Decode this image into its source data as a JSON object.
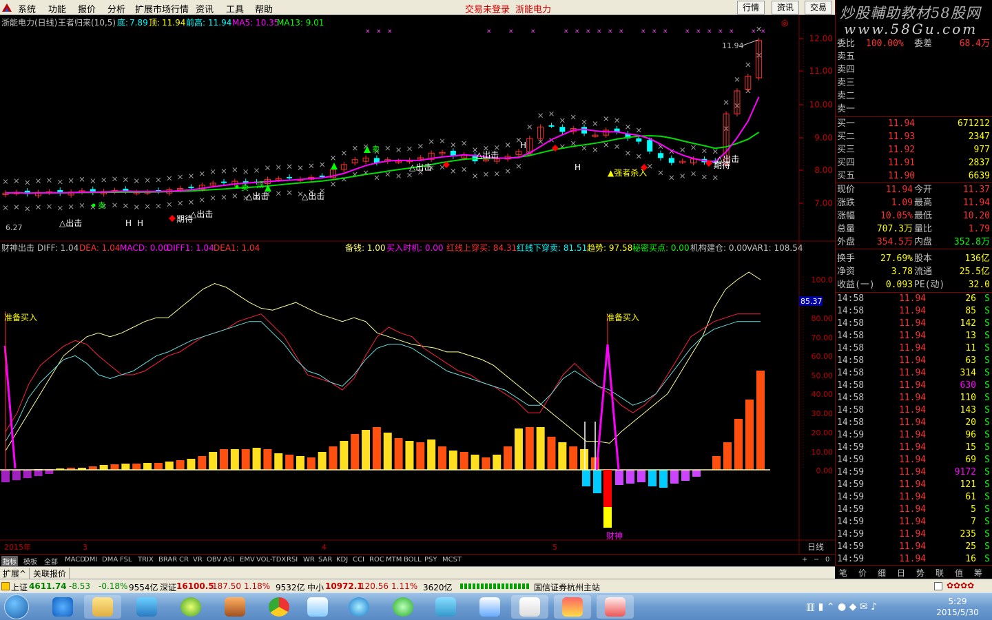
{
  "menu": {
    "items": [
      "系统",
      "功能",
      "报价",
      "分析",
      "扩展市场行情",
      "资讯",
      "工具",
      "帮助"
    ],
    "status_login": "交易未登录",
    "status_stock": "浙能电力",
    "right_buttons": [
      "行情",
      "资讯",
      "交易"
    ]
  },
  "banner": {
    "line1": "炒股輔助教材58股网",
    "line2": "www.58Gu.com"
  },
  "chart_header": {
    "title": "浙能电力(日线)",
    "indicator": "王者归来(10,5)",
    "bottom_label": "底:",
    "bottom_val": "7.89",
    "top_label": "顶:",
    "top_val": "11.94",
    "prev_high_label": "前高:",
    "prev_high_val": "11.94",
    "ma5": "MA5: 10.35",
    "ma13": "MA13: 9.01"
  },
  "price_axis": [
    "12.00",
    "11.00",
    "10.00",
    "9.00",
    "8.00",
    "7.00"
  ],
  "price_annotations": {
    "high": "11.94",
    "low": "6.27"
  },
  "chart_labels": {
    "exit": "△出击",
    "wait": "期待",
    "sell": "卖",
    "top": "顶",
    "buy_kill": "▲强者杀入",
    "h": "H"
  },
  "sub_header": {
    "name": "财神出击",
    "diff": "DIFF: 1.04",
    "dea": "DEA: 1.04",
    "macd": "MACD: 0.00",
    "diff1": "DIFF1: 1.04",
    "dea1": "DEA1: 1.04",
    "beiqian": "备钱: 1.00",
    "buytime": "买入时机: 0.00",
    "redup": "红线上穿买: 84.31",
    "reddown": "红线下穿卖: 81.51",
    "trend": "趋势: 97.58",
    "secret": "秘密买点: 0.00",
    "inst": "机构建仓: 0.00",
    "var1": "VAR1: 108.54"
  },
  "sub_axis": [
    "100.0",
    "80.00",
    "70.00",
    "60.00",
    "50.00",
    "40.00",
    "30.00",
    "20.00",
    "10.00",
    "0.00"
  ],
  "sub_marker": "85.37",
  "sub_labels": {
    "prep_buy": "准备买入",
    "caishen": "财神"
  },
  "time_axis": {
    "year": "2015年",
    "m3": "3",
    "m4": "4",
    "m5": "5",
    "period": "日线"
  },
  "indicator_tabs": [
    "指标",
    "模板",
    "全部",
    "MACD",
    "DMI",
    "DMA",
    "FSL",
    "TRIX",
    "BRAR",
    "CR",
    "VR",
    "OBV",
    "ASI",
    "EMV",
    "VOL-TDX",
    "RSI",
    "WR",
    "SAR",
    "KDJ",
    "CCI",
    "ROC",
    "MTM",
    "BOLL",
    "PSY",
    "MCST"
  ],
  "indicator_controls": [
    "+",
    "−",
    "0"
  ],
  "bottom_tabs": [
    "扩展^",
    "关联报价"
  ],
  "sell_rows": [
    [
      "委比",
      "100.00%",
      "委差",
      "68.4万"
    ],
    [
      "卖五"
    ],
    [
      "卖四"
    ],
    [
      "卖三"
    ],
    [
      "卖二"
    ],
    [
      "卖一"
    ]
  ],
  "buy_rows": [
    [
      "买一",
      "11.94",
      "671212"
    ],
    [
      "买二",
      "11.93",
      "2347"
    ],
    [
      "买三",
      "11.92",
      "977"
    ],
    [
      "买四",
      "11.91",
      "2837"
    ],
    [
      "买五",
      "11.90",
      "6639"
    ]
  ],
  "stats": [
    [
      "现价",
      "11.94",
      "今开",
      "11.37"
    ],
    [
      "涨跌",
      "1.09",
      "最高",
      "11.94"
    ],
    [
      "涨幅",
      "10.05%",
      "最低",
      "10.20"
    ],
    [
      "总量",
      "707.3万",
      "量比",
      "1.79"
    ],
    [
      "外盘",
      "354.5万",
      "内盘",
      "352.8万"
    ],
    [
      "换手",
      "27.69%",
      "股本",
      "136亿"
    ],
    [
      "净资",
      "3.78",
      "流通",
      "25.5亿"
    ],
    [
      "收益(一)",
      "0.093",
      "PE(动)",
      "32.0"
    ]
  ],
  "ticks": [
    [
      "14:58",
      "11.94",
      "26",
      "S"
    ],
    [
      "14:58",
      "11.94",
      "85",
      "S"
    ],
    [
      "14:58",
      "11.94",
      "142",
      "S"
    ],
    [
      "14:58",
      "11.94",
      "13",
      "S"
    ],
    [
      "14:58",
      "11.94",
      "11",
      "S"
    ],
    [
      "14:58",
      "11.94",
      "63",
      "S"
    ],
    [
      "14:58",
      "11.94",
      "314",
      "S"
    ],
    [
      "14:58",
      "11.94",
      "630",
      "S"
    ],
    [
      "14:58",
      "11.94",
      "110",
      "S"
    ],
    [
      "14:58",
      "11.94",
      "143",
      "S"
    ],
    [
      "14:58",
      "11.94",
      "20",
      "S"
    ],
    [
      "14:59",
      "11.94",
      "96",
      "S"
    ],
    [
      "14:59",
      "11.94",
      "15",
      "S"
    ],
    [
      "14:59",
      "11.94",
      "69",
      "S"
    ],
    [
      "14:59",
      "11.94",
      "9172",
      "S"
    ],
    [
      "14:59",
      "11.94",
      "121",
      "S"
    ],
    [
      "14:59",
      "11.94",
      "61",
      "S"
    ],
    [
      "14:59",
      "11.94",
      "5",
      "S"
    ],
    [
      "14:59",
      "11.94",
      "7",
      "S"
    ],
    [
      "14:59",
      "11.94",
      "235",
      "S"
    ],
    [
      "14:59",
      "11.94",
      "25",
      "S"
    ],
    [
      "14:59",
      "11.94",
      "16",
      "S"
    ]
  ],
  "side_tabs": [
    "笔",
    "价",
    "细",
    "日",
    "势",
    "联",
    "值",
    "筹"
  ],
  "ticker": {
    "sh_name": "上证",
    "sh_val": "4611.74",
    "sh_chg": "-8.53",
    "sh_pct": "-0.18%",
    "sh_amt": "9554亿",
    "sz_name": "深证",
    "sz_val": "16100.5",
    "sz_chg": "187.50",
    "sz_pct": "1.18%",
    "sz_amt": "9532亿",
    "zx_name": "中小",
    "zx_val": "10972.1",
    "zx_chg": "120.56",
    "zx_pct": "1.11%",
    "zx_amt": "3620亿",
    "server": "国信证券杭州主站"
  },
  "clock": {
    "time": "5:29",
    "date": "2015/5/30"
  },
  "colors": {
    "up": "#ff3030",
    "down": "#00ffff",
    "axis": "#800000",
    "ma5": "#ff00ff",
    "ma13": "#00dd00"
  }
}
